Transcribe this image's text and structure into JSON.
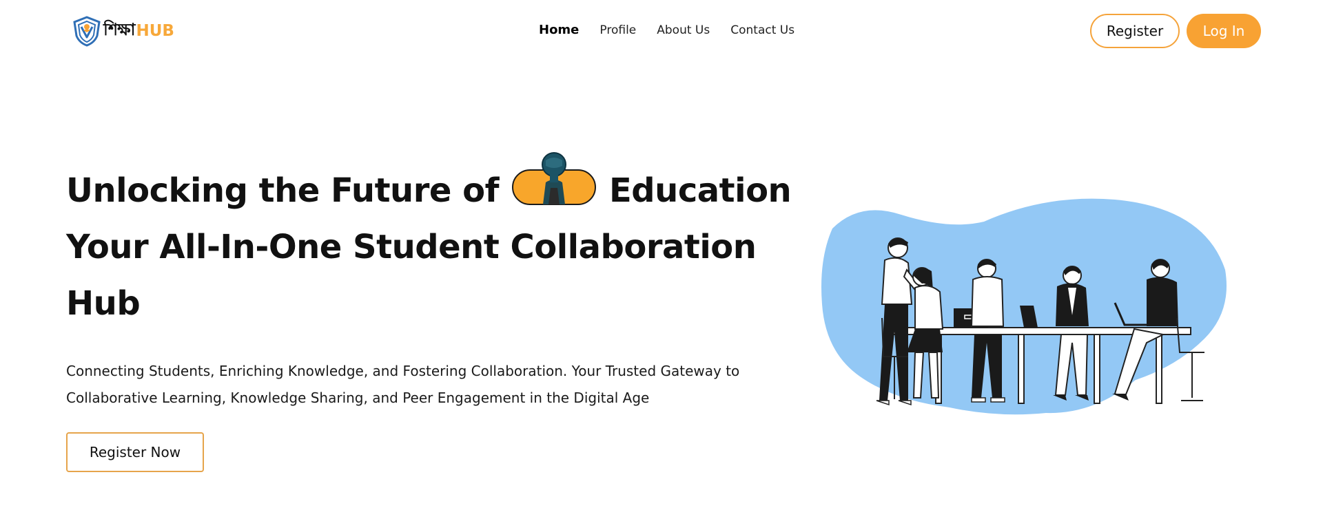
{
  "navbar": {
    "logo_script": "শিক্ষা",
    "logo_hub": "HUB",
    "links": [
      "Home",
      "Profile",
      "About Us",
      "Contact Us"
    ],
    "active_link": "Home",
    "register_label": "Register",
    "login_label": "Log In"
  },
  "hero": {
    "title_line1_a": "Unlocking the Future of",
    "title_line1_b": "Education",
    "title_line2": "Your All-In-One Student Collaboration",
    "title_line3": "Hub",
    "description": "Connecting Students, Enriching Knowledge, and Fostering Collaboration. Your Trusted Gateway to Collaborative Learning, Knowledge Sharing, and Peer Engagement in the Digital Age",
    "cta_label": "Register Now"
  },
  "colors": {
    "accent": "#F8A233",
    "accent_border": "#E6A44A",
    "illustration_blob": "#93C8F5",
    "shield_blue": "#2F6FB6",
    "text": "#111111"
  },
  "icons": {
    "logo": "shield-logo-icon",
    "pill": "astronaut-pill-image",
    "illustration": "team-collaboration-illustration"
  }
}
